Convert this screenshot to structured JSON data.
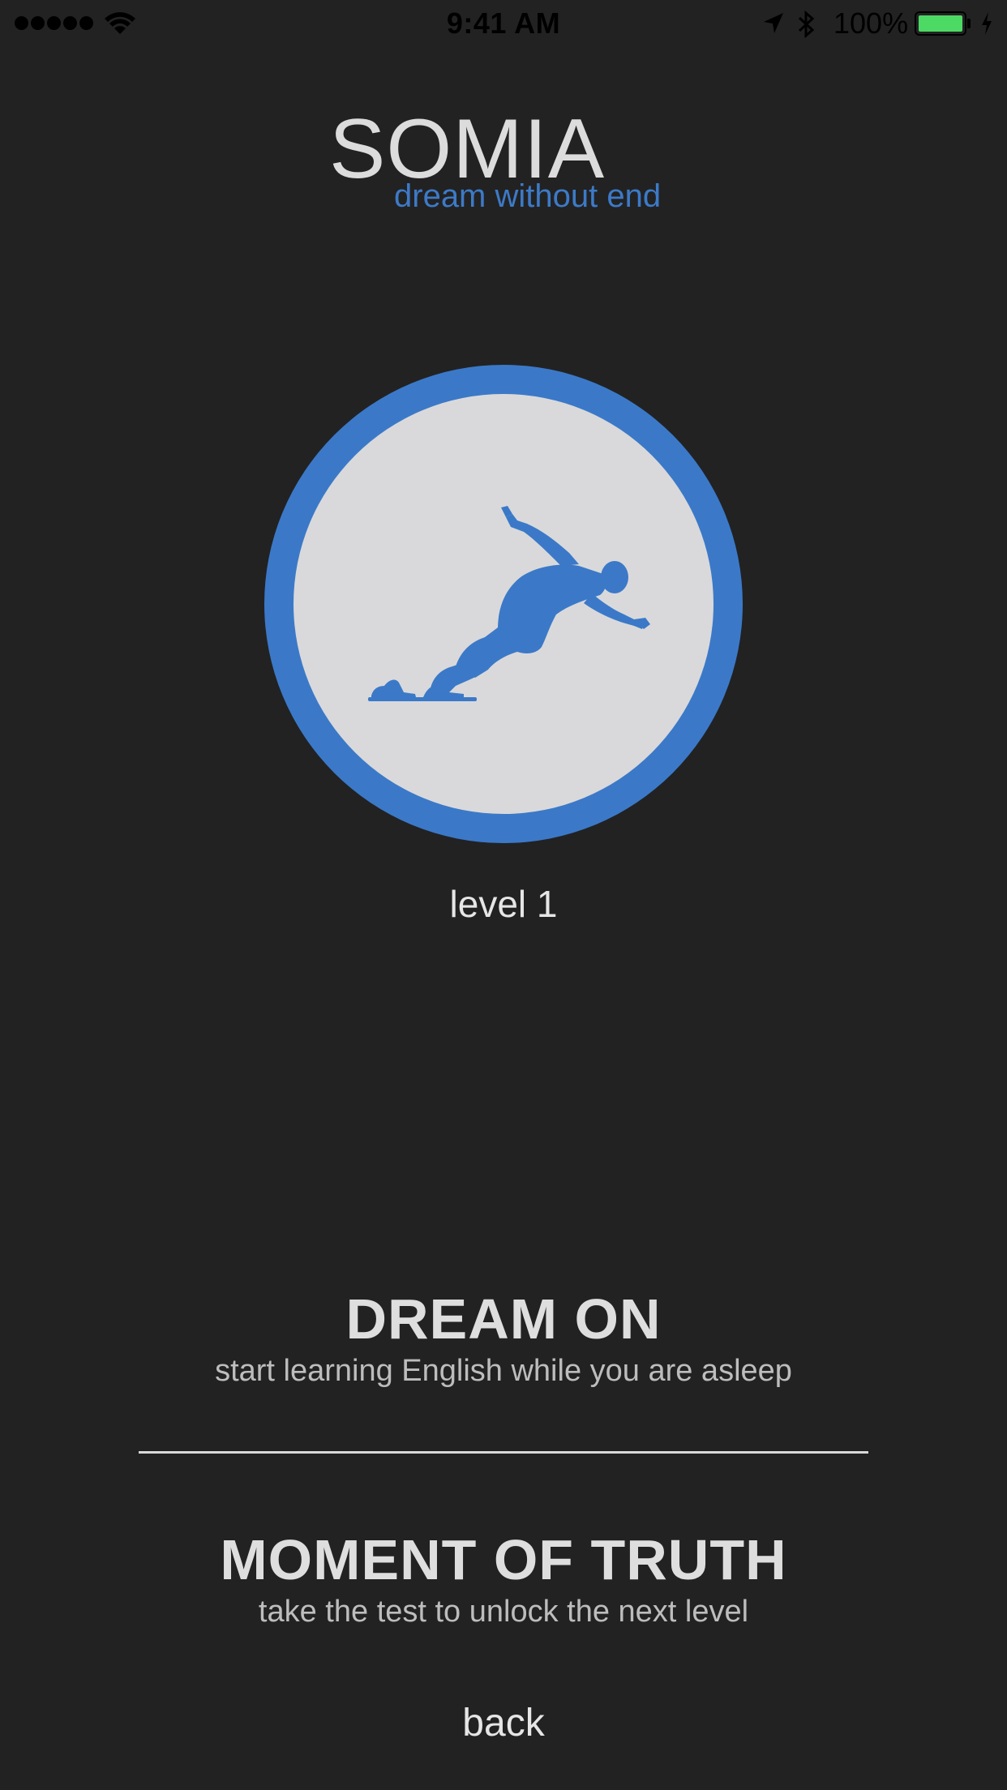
{
  "status_bar": {
    "time": "9:41 AM",
    "battery_percent": "100%",
    "signal_bars": 5,
    "icons": [
      "signal-icon",
      "wifi-icon",
      "location-icon",
      "bluetooth-icon",
      "battery-icon",
      "charging-icon"
    ],
    "battery_color": "#4cd964"
  },
  "logo": {
    "title": "SOMIA",
    "tagline": "dream without end"
  },
  "badge": {
    "icon": "sprinter-icon",
    "ring_color": "#3b79c8",
    "fill_color": "#d9d9db",
    "level_label": "level 1"
  },
  "actions": {
    "dream_on": {
      "title": "DREAM ON",
      "subtitle": "start learning English while you are asleep"
    },
    "moment_of_truth": {
      "title": "MOMENT OF TRUTH",
      "subtitle": "take the test to unlock the next level"
    }
  },
  "back_label": "back",
  "colors": {
    "background": "#222223",
    "accent": "#3b79c8",
    "text": "#dedede"
  }
}
